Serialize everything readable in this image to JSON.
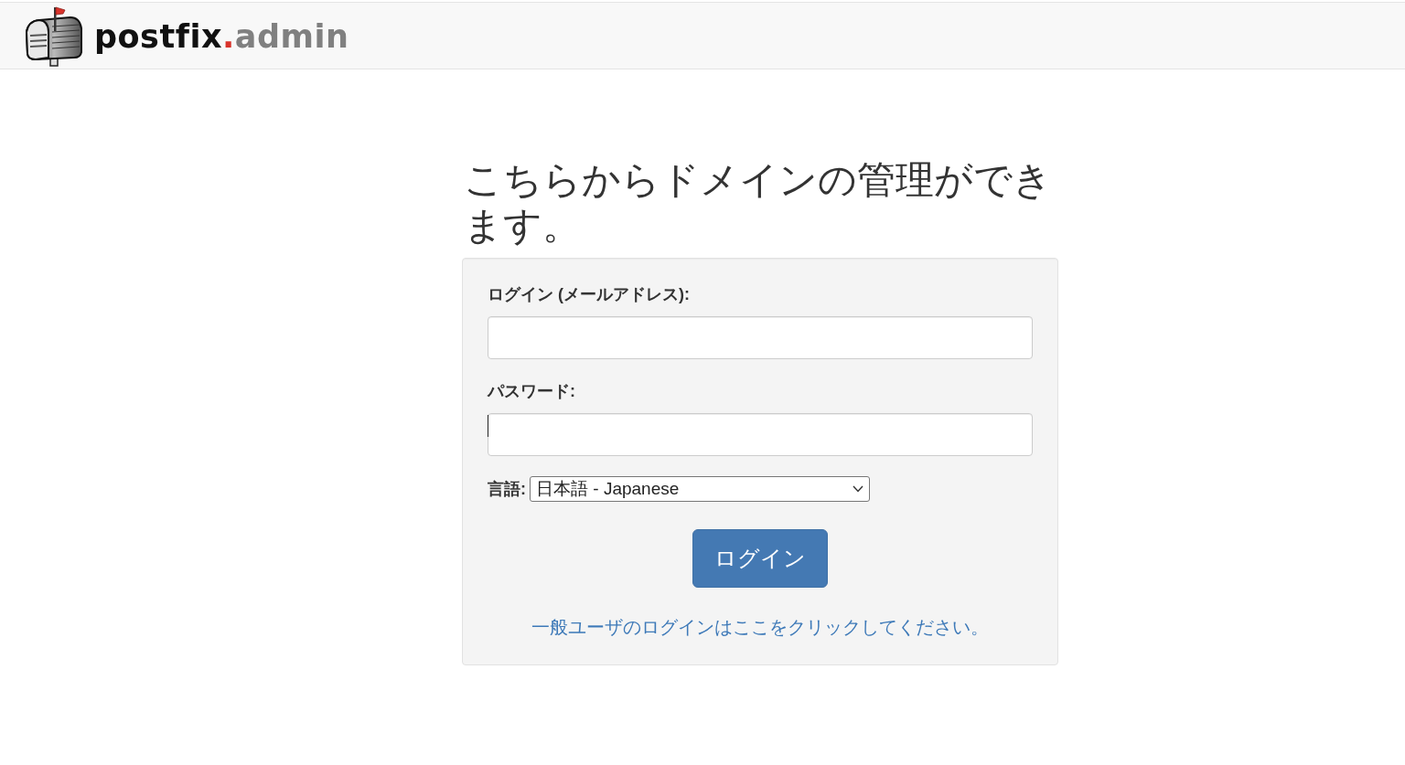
{
  "header": {
    "logo": [
      {
        "text": "postfix",
        "color": "#111111"
      },
      {
        "text": ".",
        "color": "#d9332b"
      },
      {
        "text": "admin",
        "color": "#808080"
      }
    ]
  },
  "heading": "こちらからドメインの管理ができます。",
  "form": {
    "fields": [
      {
        "label": "ログイン (メールアドレス):",
        "focused": false
      },
      {
        "label": "パスワード:",
        "focused": true
      }
    ],
    "language": {
      "label": "言語:",
      "value": "日本語 - Japanese"
    },
    "submit": "ログイン",
    "user_link": "一般ユーザのログインはここをクリックしてください。"
  }
}
